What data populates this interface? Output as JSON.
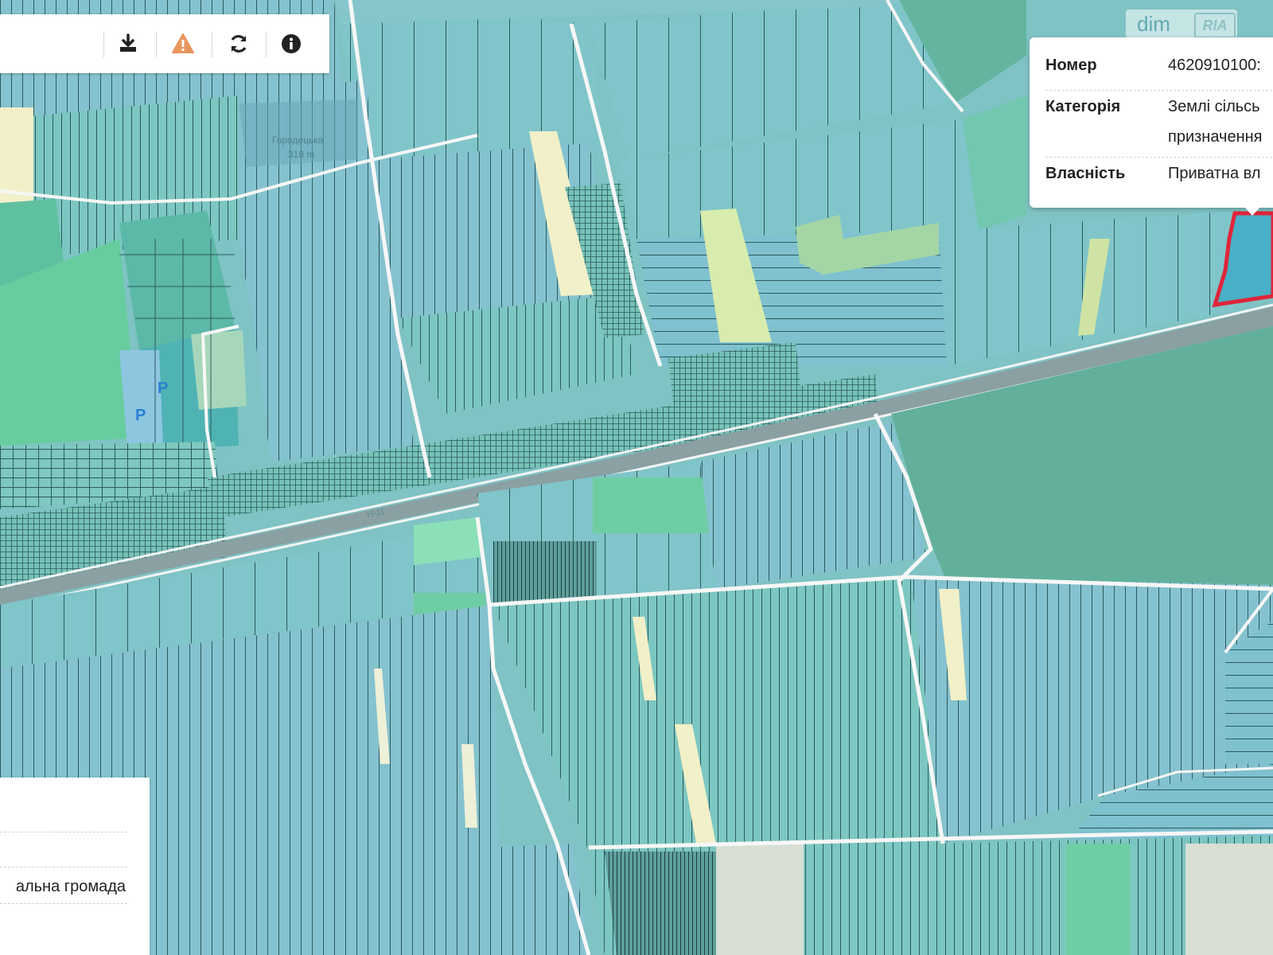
{
  "toolbar": {
    "buttons": [
      {
        "name": "download-icon",
        "glyph": "download"
      },
      {
        "name": "warning-icon",
        "glyph": "warning"
      },
      {
        "name": "refresh-icon",
        "glyph": "refresh"
      },
      {
        "name": "info-icon",
        "glyph": "info"
      }
    ]
  },
  "popup": {
    "rows": [
      {
        "label": "Номер",
        "value": "4620910100:"
      },
      {
        "label": "Категорія",
        "value": "Землі сільсь",
        "value2": "призначення"
      },
      {
        "label": "Власність",
        "value": "Приватна вл"
      }
    ]
  },
  "info_panel": {
    "text": "альна громада"
  },
  "map_labels": {
    "water": "Городецька",
    "water_height": "318 m",
    "road": "Н-11",
    "parking_1": "P",
    "parking_2": "P"
  },
  "watermark": {
    "left": "dim",
    "right": "RIA"
  },
  "colors": {
    "field": "#7fc3c4",
    "parcel_blue": "#88c3d8",
    "parcel_green": "#6fcda3",
    "forest": "#62b09c",
    "road": "#ffffff",
    "highway": "#8aa0a3",
    "highlight": "#e0253a",
    "warning": "#e8955e"
  }
}
